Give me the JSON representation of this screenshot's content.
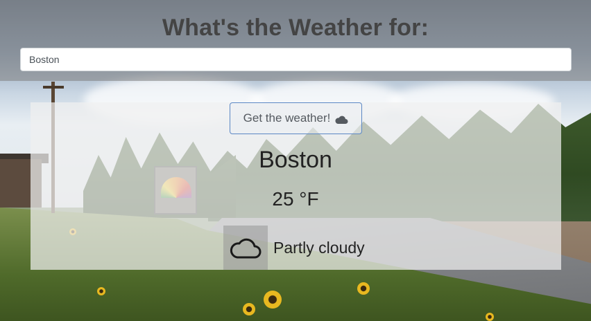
{
  "header": {
    "title": "What's the Weather for:"
  },
  "search": {
    "value": "Boston",
    "placeholder": ""
  },
  "action": {
    "button_label": "Get the weather!",
    "button_icon": "cloud-icon"
  },
  "result": {
    "city": "Boston",
    "temperature": "25 °F",
    "condition": "Partly cloudy",
    "condition_icon": "cloud-outline-icon"
  },
  "background": {
    "description_icon": "scenic-road-photo"
  }
}
